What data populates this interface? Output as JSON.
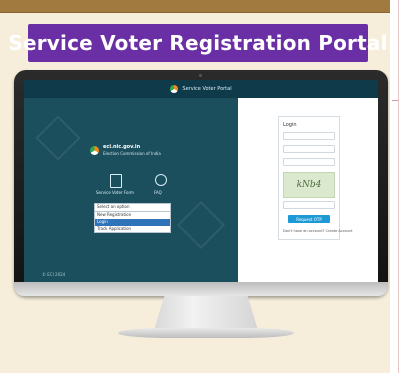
{
  "banner": {
    "title": "Service Voter Registration Portal"
  },
  "screen": {
    "header_text": "Service Voter Portal",
    "eci": {
      "title": "eci.nic.gov.in",
      "subtitle": "Election Commission of India"
    },
    "links": [
      {
        "label": "Service Voter Form"
      },
      {
        "label": "FAQ"
      }
    ],
    "dropdown": {
      "header": "Select an option",
      "options": [
        "New Registration",
        "Login",
        "Track Application"
      ],
      "selected_index": 1
    },
    "footer": "© ECI 2024",
    "login": {
      "title": "Login",
      "captcha_text": "kNb4",
      "button_label": "Request OTP",
      "help_text": "Don't have an account? Create Account"
    }
  },
  "colors": {
    "banner": "#6a2fa5",
    "screen_left": "#1c4f5e",
    "screen_topbar": "#0f3a4a",
    "primary_button": "#1d9ad6",
    "dropdown_selected": "#2f73b8"
  }
}
